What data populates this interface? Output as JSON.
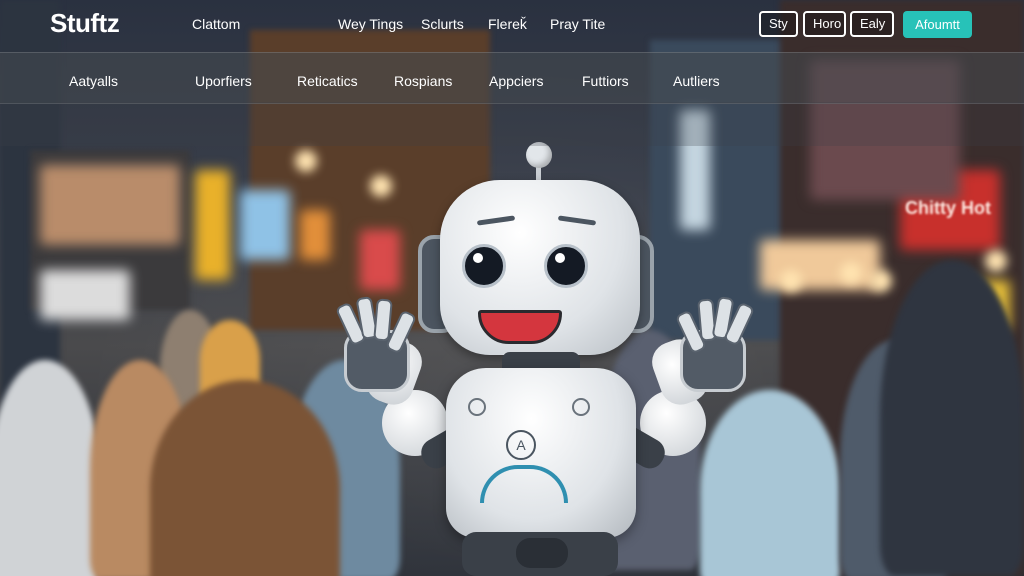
{
  "header": {
    "logo": "Stuftz",
    "nav_links": [
      "Clattom",
      "Wey Tings",
      "Sclurts",
      "Flereǩ",
      "Pray Tite"
    ],
    "buttons": [
      "Sty",
      "Horo",
      "Ealy"
    ],
    "cta_label": "Afoumtt"
  },
  "subnav": {
    "items": [
      "Aatyalls",
      "Uporfiers",
      "Reticatics",
      "Rospians",
      "Appciers",
      "Futtiors",
      "Autliers"
    ]
  },
  "scene": {
    "sign_text": "Chitty Hot"
  },
  "colors": {
    "cta": "#27c2b8",
    "robot_accent": "#2f8fb0",
    "mouth": "#d4363e"
  }
}
